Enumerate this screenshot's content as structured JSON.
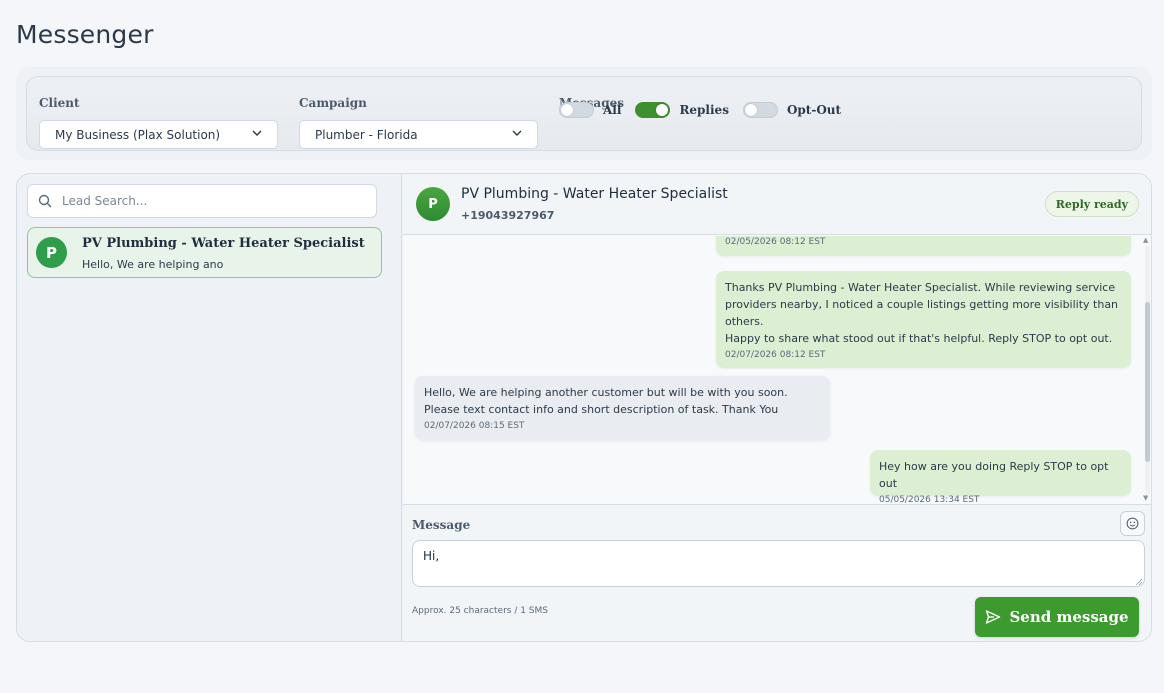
{
  "page": {
    "title": "Messenger"
  },
  "filters": {
    "client_label": "Client",
    "client_value": "My Business (Plax Solution)",
    "campaign_label": "Campaign",
    "campaign_value": "Plumber - Florida",
    "messages_label": "Messages",
    "toggles": [
      {
        "label": "All",
        "on": false
      },
      {
        "label": "Replies",
        "on": true
      },
      {
        "label": "Opt-Out",
        "on": false
      }
    ]
  },
  "sidebar": {
    "search_placeholder": "Lead Search...",
    "leads": [
      {
        "initial": "P",
        "name": "PV Plumbing - Water Heater Specialist",
        "preview": "Hello, We are helping ano"
      }
    ]
  },
  "chat": {
    "contact_initial": "P",
    "contact_name": "PV Plumbing - Water Heater Specialist",
    "contact_phone": "+19043927967",
    "status_badge": "Reply ready",
    "messages": [
      {
        "direction": "out",
        "text": "",
        "time": "02/05/2026 08:12 EST"
      },
      {
        "direction": "out",
        "text": "Thanks PV Plumbing - Water Heater Specialist. While reviewing service providers nearby, I noticed a couple listings getting more visibility than others.",
        "text2": "Happy to share what stood out if that's helpful. Reply STOP to opt out.",
        "time": "02/07/2026 08:12 EST"
      },
      {
        "direction": "in",
        "text": "Hello, We are helping another customer but will be with you soon. Please text contact info and short description of task. Thank You",
        "time": "02/07/2026 08:15 EST"
      },
      {
        "direction": "out",
        "text": "Hey how are you doing Reply STOP to opt out",
        "time": "05/05/2026 13:34 EST"
      }
    ]
  },
  "composer": {
    "label": "Message",
    "value": "Hi,",
    "char_info": "Approx. 25 characters / 1 SMS",
    "send_label": "Send message"
  },
  "colors": {
    "accent": "#3c9a2e",
    "outgoing_bubble": "#dcefd3",
    "incoming_bubble": "#e9edf1"
  }
}
